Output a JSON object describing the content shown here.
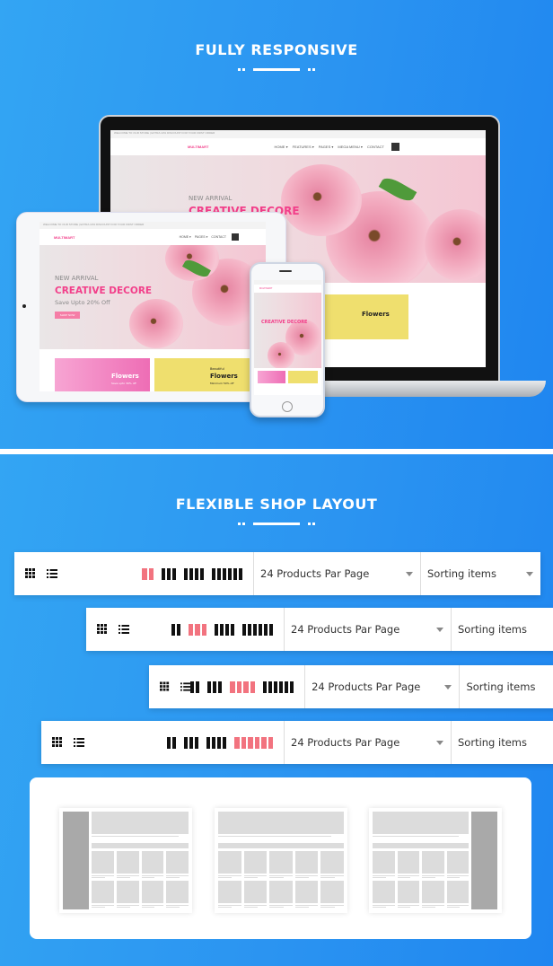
{
  "section1": {
    "title": "FULLY RESPONSIVE"
  },
  "section2": {
    "title": "FLEXIBLE  SHOP LAYOUT"
  },
  "site": {
    "topbar": "WELCOME TO OUR STORE  |  EXTRA 10% DISCOUNT FOR YOUR FIRST ORDER",
    "topbar_right": "English ▾   USD ▾   My Account",
    "logo": "MULTIMART",
    "nav": [
      "HOME ▾",
      "FEATURES ▾",
      "PAGES ▾",
      "MEGA MENU ▾",
      "CONTACT"
    ],
    "hero_kicker": "NEW ARRIVAL",
    "hero_title": "CREATIVE DECORE",
    "hero_sub": "Save Upto 20% Off",
    "hero_button": "SHOP NOW",
    "banner1_title": "Flowers",
    "banner1_sub": "Save upto 30% off",
    "banner2_kicker": "Beautiful",
    "banner2_title": "Flowers",
    "banner2_sub": "Minimum 50% off"
  },
  "toolbars": [
    {
      "active_columns": 2
    },
    {
      "active_columns": 3
    },
    {
      "active_columns": 4
    },
    {
      "active_columns": 6
    }
  ],
  "toolbar": {
    "column_options": [
      2,
      3,
      4,
      6
    ],
    "per_page": "24 Products Par Page",
    "sorting": "Sorting items",
    "active_color": "#f2737f"
  },
  "layouts": [
    "left-sidebar",
    "full-width",
    "right-sidebar"
  ]
}
